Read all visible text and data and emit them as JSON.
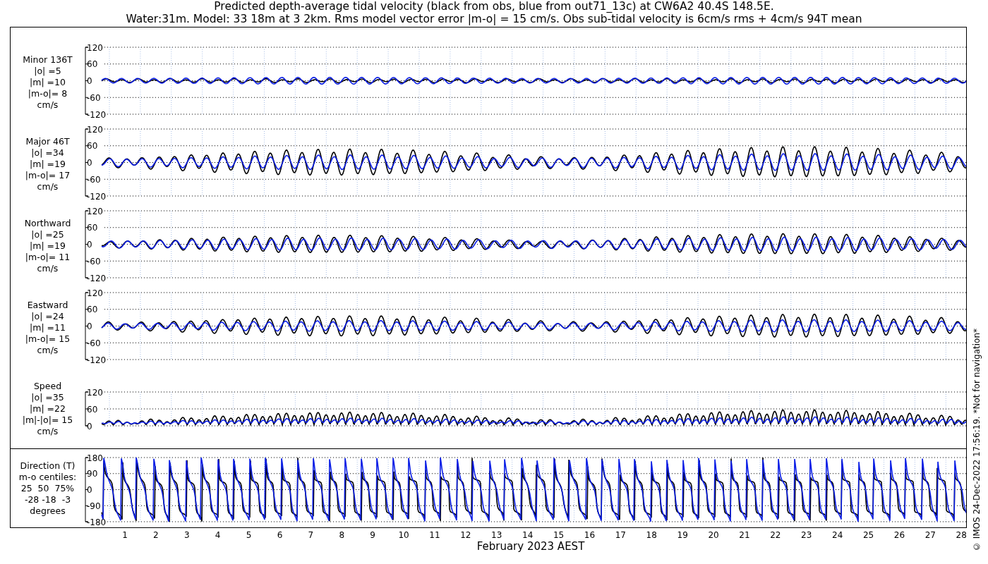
{
  "title": {
    "lines": [
      "Predicted depth-average tidal velocity (black from obs, blue from out71_13c) at CW6A2 40.4S 148.5E.",
      "Water:31m. Model: 33 18m at 3 2km. Rms model vector error |m-o| = 15 cm/s. Obs sub-tidal velocity is 6cm/s rms + 4cm/s 94T mean"
    ]
  },
  "panels": [
    {
      "kind": "minor",
      "label_lines": [
        "Minor 136T",
        "|o| =5",
        "|m| =10",
        "|m-o|= 8",
        "cm/s"
      ],
      "yticks": [
        "120",
        "60",
        "0",
        "-60",
        "-120"
      ]
    },
    {
      "kind": "major",
      "label_lines": [
        "Major 46T",
        "|o| =34",
        "|m| =19",
        "|m-o|= 17",
        "cm/s"
      ],
      "yticks": [
        "120",
        "60",
        "0",
        "-60",
        "-120"
      ]
    },
    {
      "kind": "north",
      "label_lines": [
        "Northward",
        "|o| =25",
        "|m| =19",
        "|m-o|= 11",
        "cm/s"
      ],
      "yticks": [
        "120",
        "60",
        "0",
        "-60",
        "-120"
      ]
    },
    {
      "kind": "east",
      "label_lines": [
        "Eastward",
        "|o| =24",
        "|m| =11",
        "|m-o|= 15",
        "cm/s"
      ],
      "yticks": [
        "120",
        "60",
        "0",
        "-60",
        "-120"
      ]
    },
    {
      "kind": "speed",
      "label_lines": [
        "Speed",
        "|o| =35",
        "|m| =22",
        "|m|-|o|= 15",
        "cm/s"
      ],
      "yticks": [
        "120",
        "60",
        "0"
      ]
    },
    {
      "kind": "direction",
      "label_lines": [
        "Direction (T)",
        "m-o centiles:",
        "25  50  75%",
        "-28 -18  -3",
        "degrees"
      ],
      "yticks": [
        "180",
        "90",
        "0",
        "-90",
        "-180"
      ]
    }
  ],
  "x_axis": {
    "ticks": [
      "1",
      "2",
      "3",
      "4",
      "5",
      "6",
      "7",
      "8",
      "9",
      "10",
      "11",
      "12",
      "13",
      "14",
      "15",
      "16",
      "17",
      "18",
      "19",
      "20",
      "21",
      "22",
      "23",
      "24",
      "25",
      "26",
      "27",
      "28"
    ],
    "label": "February 2023 AEST"
  },
  "notice": "© IMOS 24-Dec-2022 17:56:19.  *Not for navigation*"
}
